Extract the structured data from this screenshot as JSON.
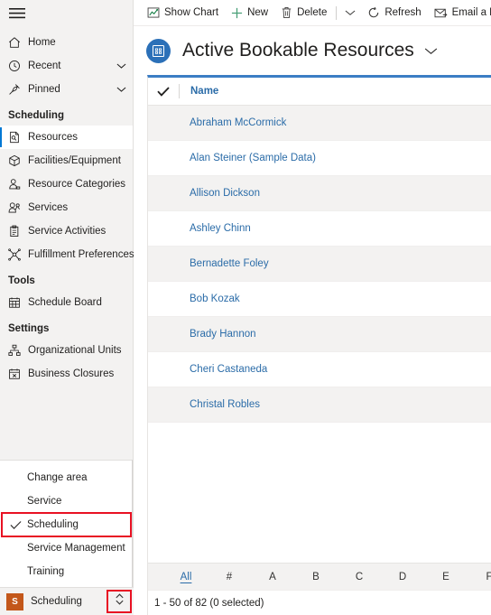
{
  "sidebar": {
    "hamburger_label": "site-map-menu",
    "top_nav": [
      {
        "label": "Home",
        "icon": "home-icon",
        "chevron": false
      },
      {
        "label": "Recent",
        "icon": "clock-icon",
        "chevron": true
      },
      {
        "label": "Pinned",
        "icon": "pin-icon",
        "chevron": true
      }
    ],
    "groups": [
      {
        "title": "Scheduling",
        "items": [
          {
            "label": "Resources",
            "icon": "resource-document-icon",
            "selected": true
          },
          {
            "label": "Facilities/Equipment",
            "icon": "box-icon",
            "selected": false
          },
          {
            "label": "Resource Categories",
            "icon": "person-category-icon",
            "selected": false
          },
          {
            "label": "Services",
            "icon": "person-service-icon",
            "selected": false
          },
          {
            "label": "Service Activities",
            "icon": "clipboard-icon",
            "selected": false
          },
          {
            "label": "Fulfillment Preferences",
            "icon": "preferences-icon",
            "selected": false
          }
        ]
      },
      {
        "title": "Tools",
        "items": [
          {
            "label": "Schedule Board",
            "icon": "calendar-board-icon",
            "selected": false
          }
        ]
      },
      {
        "title": "Settings",
        "items": [
          {
            "label": "Organizational Units",
            "icon": "org-chart-icon",
            "selected": false
          },
          {
            "label": "Business Closures",
            "icon": "calendar-x-icon",
            "selected": false
          }
        ]
      }
    ],
    "area_flyout": {
      "heading": "Change area",
      "options": [
        {
          "label": "Service",
          "checked": false,
          "highlighted": false
        },
        {
          "label": "Scheduling",
          "checked": true,
          "highlighted": true
        },
        {
          "label": "Service Management",
          "checked": false,
          "highlighted": false
        },
        {
          "label": "Training",
          "checked": false,
          "highlighted": false
        }
      ]
    },
    "area_bar": {
      "badge": "S",
      "name": "Scheduling",
      "toggle_icon": "chevron-up-down-icon",
      "badge_color": "#c3571a",
      "highlight_color": "#e81123"
    }
  },
  "commandbar": {
    "items": [
      {
        "label": "Show Chart",
        "icon": "chart-icon"
      },
      {
        "label": "New",
        "icon": "plus-icon"
      },
      {
        "label": "Delete",
        "icon": "trash-icon"
      },
      {
        "label": "",
        "icon": "chevron-down-icon"
      },
      {
        "label": "Refresh",
        "icon": "refresh-icon"
      },
      {
        "label": "Email a Link",
        "icon": "email-link-icon"
      }
    ]
  },
  "view": {
    "title": "Active Bookable Resources",
    "title_icon": "view-entity-icon",
    "title_chevron": "chevron-down-icon",
    "accent_color": "#3b7dc4"
  },
  "grid": {
    "select_all_icon": "checkmark-icon",
    "columns": [
      "Name"
    ],
    "rows": [
      {
        "name": "Abraham McCormick"
      },
      {
        "name": "Alan Steiner (Sample Data)"
      },
      {
        "name": "Allison Dickson"
      },
      {
        "name": "Ashley Chinn"
      },
      {
        "name": "Bernadette Foley"
      },
      {
        "name": "Bob Kozak"
      },
      {
        "name": "Brady Hannon"
      },
      {
        "name": "Cheri Castaneda"
      },
      {
        "name": "Christal Robles"
      }
    ]
  },
  "alphabar": {
    "letters": [
      "All",
      "#",
      "A",
      "B",
      "C",
      "D",
      "E",
      "F"
    ],
    "selected": "All"
  },
  "status": {
    "text": "1 - 50 of 82 (0 selected)"
  }
}
